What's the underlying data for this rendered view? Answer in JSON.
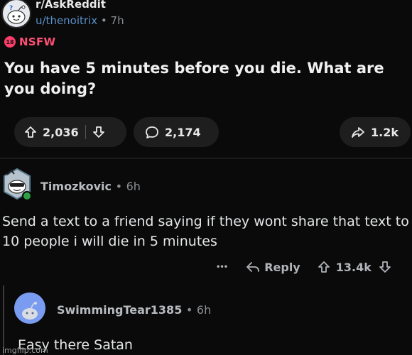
{
  "post": {
    "subreddit": "r/AskReddit",
    "author": "u/thenoitrix",
    "separator": "•",
    "age": "7h",
    "nsfw_badge": "18",
    "nsfw_label": "NSFW",
    "title": "You have 5 minutes before you die. What are you doing?",
    "upvotes": "2,036",
    "comments": "2,174",
    "shares": "1.2k"
  },
  "comments": [
    {
      "author": "Timozkovic",
      "separator": "•",
      "age": "6h",
      "body": "Send a text to a friend saying if they wont share that text to 10 people i will die in 5 minutes",
      "more": "•••",
      "reply_label": "Reply",
      "score": "13.4k"
    },
    {
      "author": "SwimmingTear1385",
      "separator": "•",
      "age": "6h",
      "body": "Easy there Satan"
    }
  ],
  "watermark": "imgflip.com",
  "colors": {
    "background": "#0a0a0a",
    "pill": "#1e1e1e",
    "nsfw": "#ff4f74",
    "username_link": "#5a8fc7"
  },
  "icons": [
    "subreddit-avatar-icon",
    "nsfw-badge-icon",
    "upvote-icon",
    "downvote-icon",
    "comment-bubble-icon",
    "share-arrow-icon",
    "more-options-icon",
    "reply-arrow-icon",
    "user-avatar-icon"
  ]
}
